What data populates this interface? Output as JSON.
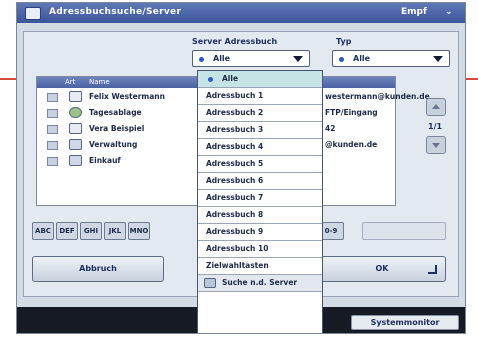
{
  "window": {
    "title": "Adressbuchsuche/Server",
    "user": "Empf",
    "more_indicator": "⌄"
  },
  "filters": {
    "server_label": "Server Adressbuch",
    "server_value": "Alle",
    "type_label": "Typ",
    "type_value": "Alle"
  },
  "list": {
    "columns": [
      "Art",
      "Name"
    ],
    "rows": [
      {
        "name": "Felix Westermann",
        "extra": "westermann@kunden.de",
        "icon": "person-card-icon"
      },
      {
        "name": "Tagesablage",
        "extra": "FTP/Eingang",
        "icon": "group-icon"
      },
      {
        "name": "Vera Beispiel",
        "extra": "42",
        "icon": "fax-icon"
      },
      {
        "name": "Verwaltung",
        "extra": "@kunden.de",
        "icon": "address-book-icon"
      },
      {
        "name": "Einkauf",
        "extra": "",
        "icon": "address-book-icon"
      }
    ],
    "page_indicator": "1/1"
  },
  "keys": [
    "ABC",
    "DEF",
    "GHI",
    "JKL",
    "MNO",
    "0-9"
  ],
  "buttons": {
    "cancel": "Abbruch",
    "ok": "OK",
    "system_monitor": "Systemmonitor"
  },
  "dropdown": {
    "selected": "Alle",
    "items": [
      "Adressbuch 1",
      "Adressbuch 2",
      "Adressbuch 3",
      "Adressbuch 4",
      "Adressbuch 5",
      "Adressbuch 6",
      "Adressbuch 7",
      "Adressbuch 8",
      "Adressbuch 9",
      "Adressbuch 10",
      "Zielwahltasten"
    ],
    "search_server": "Suche n.d. Server"
  }
}
